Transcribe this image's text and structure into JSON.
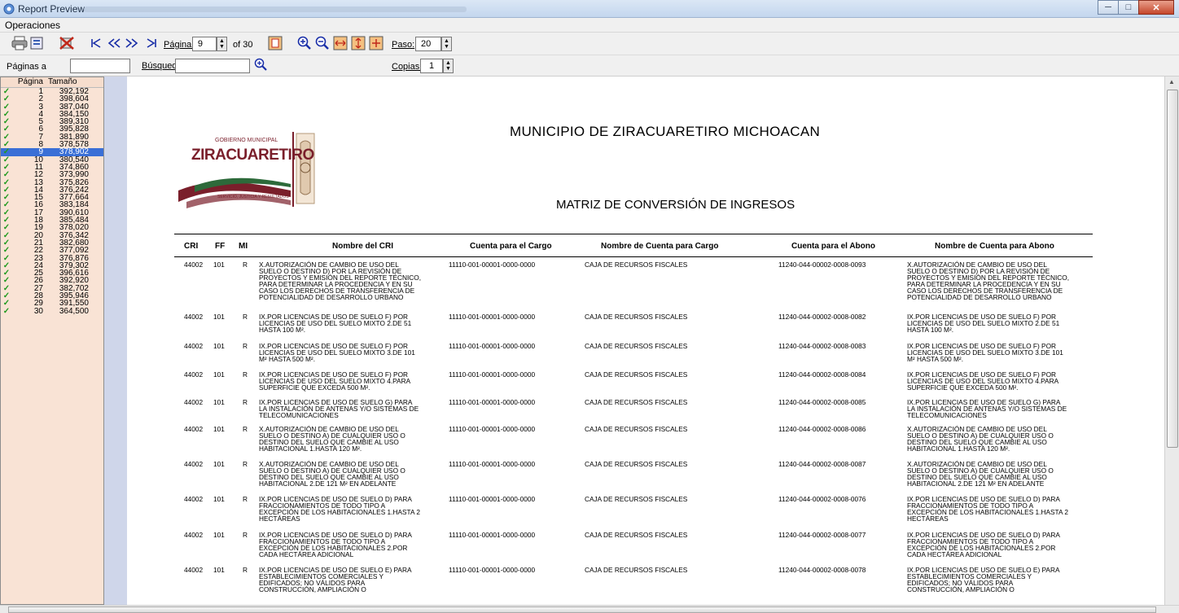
{
  "window": {
    "title": "Report Preview",
    "minimize": "─",
    "maximize": "□",
    "close": "✕"
  },
  "menu": {
    "operaciones": "Operaciones"
  },
  "toolbar": {
    "pagina_label": "Página:",
    "pagina_value": "9",
    "of_label": "of 30",
    "paso_label": "Paso:",
    "paso_value": "20",
    "icons": [
      "printer-icon",
      "export-icon",
      "close-report-icon",
      "first-page-icon",
      "prev-page-icon",
      "next-page-icon",
      "last-page-icon",
      "fit-page-icon",
      "zoom-in-icon",
      "zoom-out-icon",
      "fit-width-icon",
      "fit-height-icon",
      "page-size-icon"
    ]
  },
  "searchbar": {
    "paginas_label": "Páginas a",
    "busqueda_label": "Búsqued",
    "copias_label": "Copias:",
    "copias_value": "1"
  },
  "pages_panel": {
    "col_pagina": "Página",
    "col_tamano": "Tamaño",
    "selected": 9,
    "rows": [
      [
        "1",
        "392,192"
      ],
      [
        "2",
        "398,604"
      ],
      [
        "3",
        "387,040"
      ],
      [
        "4",
        "384,150"
      ],
      [
        "5",
        "389,310"
      ],
      [
        "6",
        "395,828"
      ],
      [
        "7",
        "381,890"
      ],
      [
        "8",
        "378,578"
      ],
      [
        "9",
        "378,902"
      ],
      [
        "10",
        "380,540"
      ],
      [
        "11",
        "374,860"
      ],
      [
        "12",
        "373,990"
      ],
      [
        "13",
        "375,826"
      ],
      [
        "14",
        "376,242"
      ],
      [
        "15",
        "377,664"
      ],
      [
        "16",
        "383,184"
      ],
      [
        "17",
        "390,610"
      ],
      [
        "18",
        "385,484"
      ],
      [
        "19",
        "378,020"
      ],
      [
        "20",
        "376,342"
      ],
      [
        "21",
        "382,680"
      ],
      [
        "22",
        "377,092"
      ],
      [
        "23",
        "376,876"
      ],
      [
        "24",
        "379,302"
      ],
      [
        "25",
        "396,616"
      ],
      [
        "26",
        "392,920"
      ],
      [
        "27",
        "382,702"
      ],
      [
        "28",
        "395,946"
      ],
      [
        "29",
        "391,550"
      ],
      [
        "30",
        "364,500"
      ]
    ]
  },
  "report": {
    "title": "MUNICIPIO DE ZIRACUARETIRO MICHOACAN",
    "subtitle": "MATRIZ DE CONVERSIÓN DE INGRESOS",
    "logo": {
      "line1": "GOBIERNO MUNICIPAL",
      "line2": "ZIRACUARETIRO",
      "line3": "SERVICIO, JUSTICIA Y RESULTADOS"
    },
    "headers": {
      "cri": "CRI",
      "ff": "FF",
      "mi": "MI",
      "nombre_cri": "Nombre del CRI",
      "cuenta_cargo": "Cuenta para el Cargo",
      "nombre_cargo": "Nombre de Cuenta para Cargo",
      "cuenta_abono": "Cuenta para el Abono",
      "nombre_abono": "Nombre de Cuenta para Abono"
    },
    "rows": [
      {
        "cri": "44002",
        "ff": "101",
        "mi": "R",
        "nombre": "X.AUTORIZACIÓN DE CAMBIO DE USO DEL\nSUELO O DESTINO D) POR LA REVISIÓN DE\nPROYECTOS Y EMISIÓN DEL REPORTE TÉCNICO,\nPARA DETERMINAR LA PROCEDENCIA Y EN SU\nCASO LOS DERECHOS DE TRANSFERENCIA DE\nPOTENCIALIDAD DE DESARROLLO URBANO",
        "cargo": "11110-001-00001-0000-0000",
        "ncargo": "CAJA DE RECURSOS FISCALES",
        "abono": "11240-044-00002-0008-0093",
        "nabono": "X.AUTORIZACIÓN DE CAMBIO DE USO DEL\nSUELO O DESTINO D) POR LA REVISIÓN DE\nPROYECTOS Y EMISIÓN DEL REPORTE TÉCNICO,\nPARA DETERMINAR LA PROCEDENCIA Y EN SU\nCASO LOS DERECHOS DE TRANSFERENCIA DE\nPOTENCIALIDAD DE DESARROLLO URBANO"
      },
      {
        "cri": "44002",
        "ff": "101",
        "mi": "R",
        "nombre": "IX.POR LICENCIAS DE USO DE SUELO F) POR\nLICENCIAS DE USO DEL SUELO MIXTO 2.DE 51\nHASTA 100 M².",
        "cargo": "11110-001-00001-0000-0000",
        "ncargo": "CAJA DE RECURSOS FISCALES",
        "abono": "11240-044-00002-0008-0082",
        "nabono": "IX.POR LICENCIAS DE USO DE SUELO F) POR\nLICENCIAS DE USO DEL SUELO MIXTO 2.DE 51\nHASTA 100 M²."
      },
      {
        "cri": "44002",
        "ff": "101",
        "mi": "R",
        "nombre": "IX.POR LICENCIAS DE USO DE SUELO F) POR\nLICENCIAS DE USO DEL SUELO MIXTO 3.DE 101\nM² HASTA 500 M².",
        "cargo": "11110-001-00001-0000-0000",
        "ncargo": "CAJA DE RECURSOS FISCALES",
        "abono": "11240-044-00002-0008-0083",
        "nabono": "IX.POR LICENCIAS DE USO DE SUELO F) POR\nLICENCIAS DE USO DEL SUELO MIXTO 3.DE 101\nM² HASTA 500 M²."
      },
      {
        "cri": "44002",
        "ff": "101",
        "mi": "R",
        "nombre": "IX.POR LICENCIAS DE USO DE SUELO F) POR\nLICENCIAS DE USO DEL SUELO MIXTO 4.PARA\nSUPERFICIE QUE EXCEDA 500 M².",
        "cargo": "11110-001-00001-0000-0000",
        "ncargo": "CAJA DE RECURSOS FISCALES",
        "abono": "11240-044-00002-0008-0084",
        "nabono": "IX.POR LICENCIAS DE USO DE SUELO F) POR\nLICENCIAS DE USO DEL SUELO MIXTO 4.PARA\nSUPERFICIE QUE EXCEDA 500 M²."
      },
      {
        "cri": "44002",
        "ff": "101",
        "mi": "R",
        "nombre": "IX.POR LICENCIAS DE USO DE SUELO G) PARA\nLA INSTALACIÓN DE ANTENAS Y/O SISTEMAS DE\nTELECOMUNICACIONES",
        "cargo": "11110-001-00001-0000-0000",
        "ncargo": "CAJA DE RECURSOS FISCALES",
        "abono": "11240-044-00002-0008-0085",
        "nabono": "IX.POR LICENCIAS DE USO DE SUELO G) PARA\nLA INSTALACIÓN DE ANTENAS Y/O SISTEMAS DE\nTELECOMUNICACIONES"
      },
      {
        "cri": "44002",
        "ff": "101",
        "mi": "R",
        "nombre": "X.AUTORIZACIÓN DE CAMBIO DE USO DEL\nSUELO O DESTINO A) DE CUALQUIER USO O\nDESTINO DEL SUELO QUE CAMBIE AL USO\nHABITACIONAL 1.HASTA 120 M².",
        "cargo": "11110-001-00001-0000-0000",
        "ncargo": "CAJA DE RECURSOS FISCALES",
        "abono": "11240-044-00002-0008-0086",
        "nabono": "X.AUTORIZACIÓN DE CAMBIO DE USO DEL\nSUELO O DESTINO A) DE CUALQUIER USO O\nDESTINO DEL SUELO QUE CAMBIE AL USO\nHABITACIONAL 1.HASTA 120 M²."
      },
      {
        "cri": "44002",
        "ff": "101",
        "mi": "R",
        "nombre": "X.AUTORIZACIÓN DE CAMBIO DE USO DEL\nSUELO O DESTINO A) DE CUALQUIER USO O\nDESTINO DEL SUELO QUE CAMBIE AL USO\nHABITACIONAL 2.DE 121 M² EN ADELANTE",
        "cargo": "11110-001-00001-0000-0000",
        "ncargo": "CAJA DE RECURSOS FISCALES",
        "abono": "11240-044-00002-0008-0087",
        "nabono": "X.AUTORIZACIÓN DE CAMBIO DE USO DEL\nSUELO O DESTINO A) DE CUALQUIER USO O\nDESTINO DEL SUELO QUE CAMBIE AL USO\nHABITACIONAL 2.DE 121 M² EN ADELANTE"
      },
      {
        "cri": "44002",
        "ff": "101",
        "mi": "R",
        "nombre": "IX.POR LICENCIAS DE USO DE SUELO D) PARA\nFRACCIONAMIENTOS DE TODO TIPO A\nEXCEPCIÓN DE LOS HABITACIONALES 1.HASTA 2\nHECTÁREAS",
        "cargo": "11110-001-00001-0000-0000",
        "ncargo": "CAJA DE RECURSOS FISCALES",
        "abono": "11240-044-00002-0008-0076",
        "nabono": "IX.POR LICENCIAS DE USO DE SUELO D) PARA\nFRACCIONAMIENTOS DE TODO TIPO A\nEXCEPCIÓN DE LOS HABITACIONALES 1.HASTA 2\nHECTÁREAS"
      },
      {
        "cri": "44002",
        "ff": "101",
        "mi": "R",
        "nombre": "IX.POR LICENCIAS DE USO DE SUELO D) PARA\nFRACCIONAMIENTOS DE TODO TIPO A\nEXCEPCIÓN DE LOS HABITACIONALES 2.POR\nCADA HECTÁREA ADICIONAL",
        "cargo": "11110-001-00001-0000-0000",
        "ncargo": "CAJA DE RECURSOS FISCALES",
        "abono": "11240-044-00002-0008-0077",
        "nabono": "IX.POR LICENCIAS DE USO DE SUELO D) PARA\nFRACCIONAMIENTOS DE TODO TIPO A\nEXCEPCIÓN DE LOS HABITACIONALES 2.POR\nCADA HECTÁREA ADICIONAL"
      },
      {
        "cri": "44002",
        "ff": "101",
        "mi": "R",
        "nombre": "IX.POR LICENCIAS DE USO DE SUELO E) PARA\nESTABLECIMIENTOS COMERCIALES Y\nEDIFICADOS; NO VÁLIDOS PARA\nCONSTRUCCIÓN, AMPLIACIÓN O",
        "cargo": "11110-001-00001-0000-0000",
        "ncargo": "CAJA DE RECURSOS FISCALES",
        "abono": "11240-044-00002-0008-0078",
        "nabono": "IX.POR LICENCIAS DE USO DE SUELO E) PARA\nESTABLECIMIENTOS COMERCIALES Y\nEDIFICADOS; NO VÁLIDOS PARA\nCONSTRUCCIÓN, AMPLIACIÓN O"
      }
    ]
  }
}
